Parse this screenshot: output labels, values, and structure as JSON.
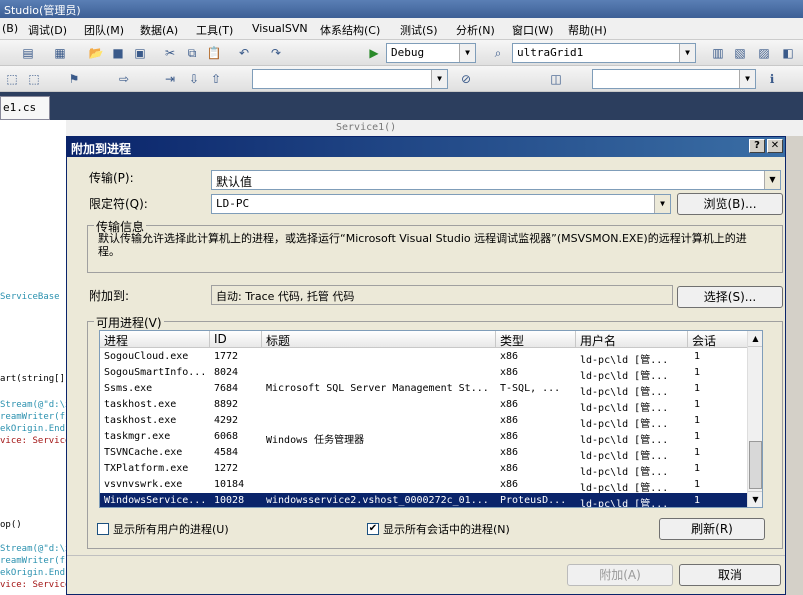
{
  "app": {
    "title": "Studio(管理员)"
  },
  "menu": [
    "(B)",
    "调试(D)",
    "团队(M)",
    "数据(A)",
    "工具(T)",
    "VisualSVN",
    "体系结构(C)",
    "测试(S)",
    "分析(N)",
    "窗口(W)",
    "帮助(H)"
  ],
  "toolbar": {
    "config": "Debug",
    "target": "ultraGrid1"
  },
  "tabs": {
    "active": "e1.cs",
    "breadcrumb": "Service1()"
  },
  "code": [
    "ServiceBase",
    "art(string[] a",
    "Stream(@\"d:\\xx",
    "reamWriter(fs)",
    "ekOrigin.End);",
    "vice: Service",
    "op()",
    "Stream(@\"d:\\xx",
    "reamWriter(fs)",
    "ekOrigin.End);",
    "vice: Service"
  ],
  "dialog": {
    "title": "附加到进程",
    "help": "?",
    "close": "✕",
    "transport_label": "传输(P):",
    "transport_value": "默认值",
    "qualifier_label": "限定符(Q):",
    "qualifier_value": "LD-PC",
    "browse_button": "浏览(B)...",
    "info_group": "传输信息",
    "info_text": "默认传输允许选择此计算机上的进程，或选择运行“Microsoft Visual Studio 远程调试监视器”(MSVSMON.EXE)的远程计算机上的进程。",
    "attach_to_label": "附加到:",
    "attach_to_value": "自动: Trace 代码, 托管 代码",
    "select_button": "选择(S)...",
    "available_group": "可用进程(V)",
    "columns": [
      "进程",
      "ID",
      "标题",
      "类型",
      "用户名",
      "会话"
    ],
    "processes": [
      [
        "SogouCloud.exe",
        "1772",
        "",
        "x86",
        "ld-pc\\ld [管...",
        "1"
      ],
      [
        "SogouSmartInfo...",
        "8024",
        "",
        "x86",
        "ld-pc\\ld [管...",
        "1"
      ],
      [
        "Ssms.exe",
        "7684",
        "Microsoft SQL Server Management St...",
        "T-SQL, ...",
        "ld-pc\\ld [管...",
        "1"
      ],
      [
        "taskhost.exe",
        "8892",
        "",
        "x86",
        "ld-pc\\ld [管...",
        "1"
      ],
      [
        "taskhost.exe",
        "4292",
        "",
        "x86",
        "ld-pc\\ld [管...",
        "1"
      ],
      [
        "taskmgr.exe",
        "6068",
        "Windows 任务管理器",
        "x86",
        "ld-pc\\ld [管...",
        "1"
      ],
      [
        "TSVNCache.exe",
        "4584",
        "",
        "x86",
        "ld-pc\\ld [管...",
        "1"
      ],
      [
        "TXPlatform.exe",
        "1272",
        "",
        "x86",
        "ld-pc\\ld [管...",
        "1"
      ],
      [
        "vsvnvswrk.exe",
        "10184",
        "",
        "x86",
        "ld-pc\\ld [管...",
        "1"
      ],
      [
        "WindowsService...",
        "10028",
        "windowsservice2.vshost_0000272c_01...",
        "ProteusD...",
        "ld-pc\\ld [管...",
        "1"
      ]
    ],
    "show_all_users": "显示所有用户的进程(U)",
    "show_all_sessions": "显示所有会话中的进程(N)",
    "refresh_button": "刷新(R)",
    "attach_button": "附加(A)",
    "cancel_button": "取消"
  }
}
